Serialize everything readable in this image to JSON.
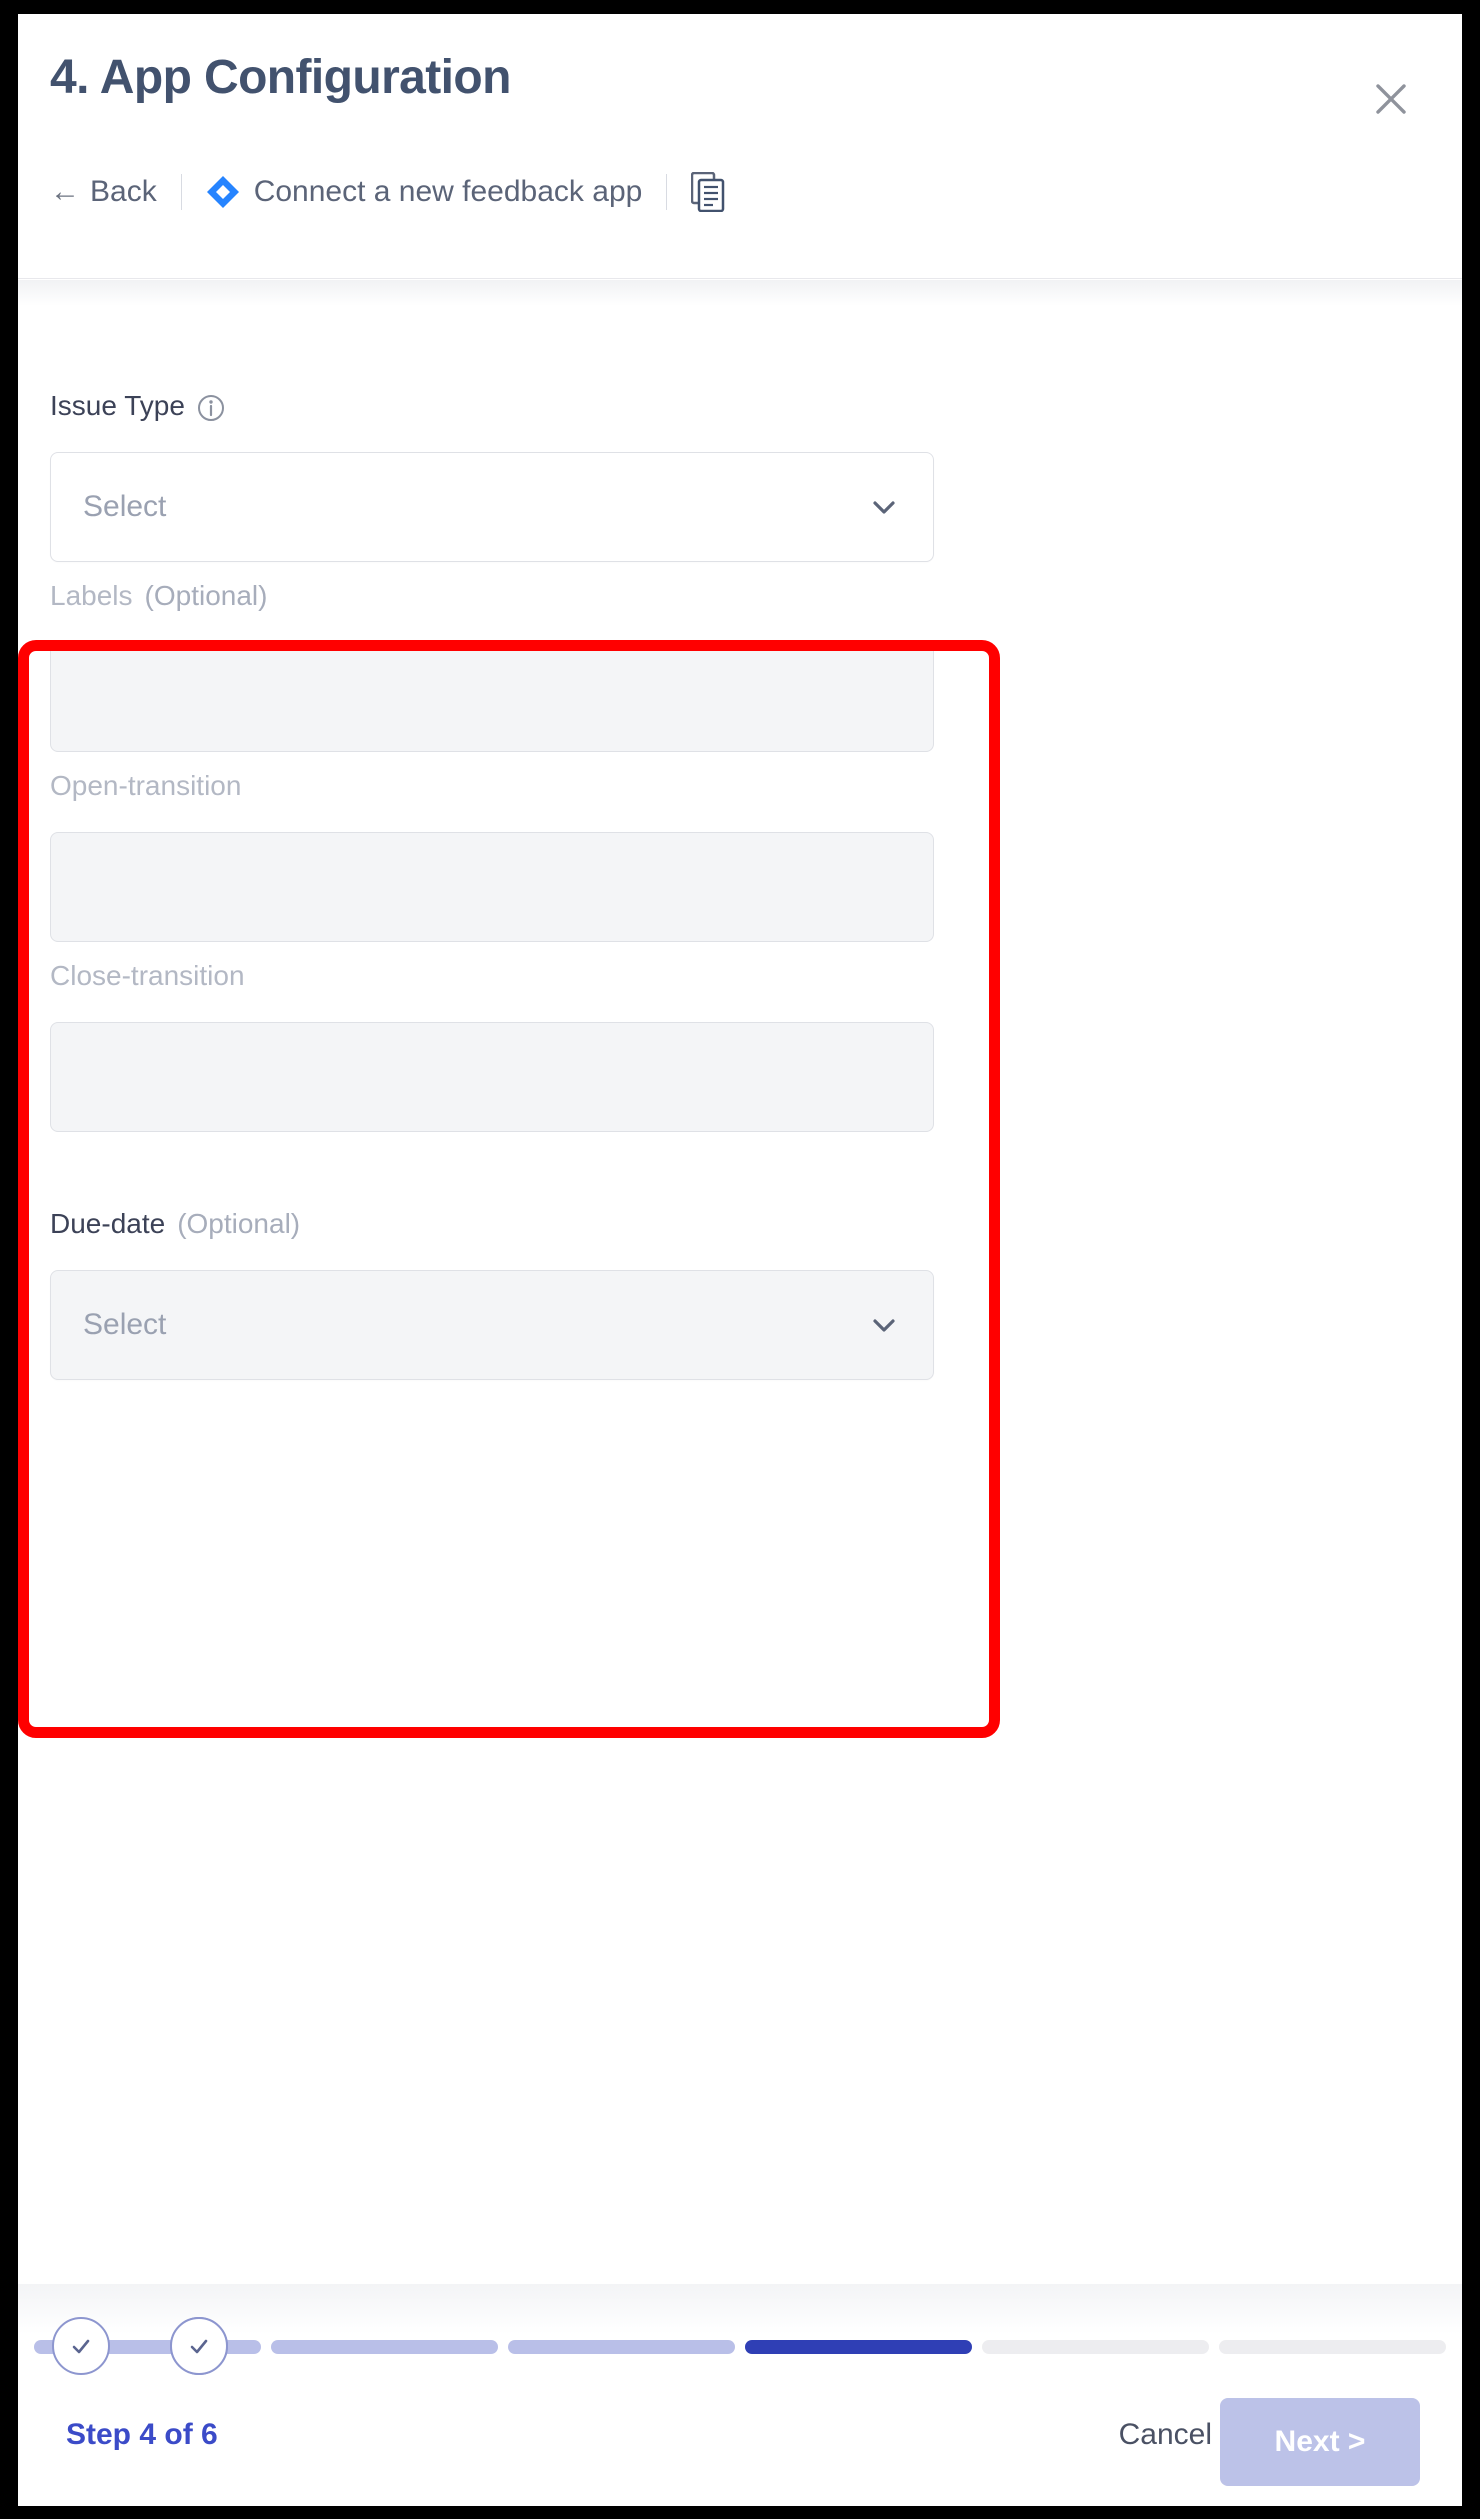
{
  "header": {
    "title": "4. App Configuration",
    "back_arrow": "←",
    "back_label": "Back",
    "app_name": "Connect a new feedback app",
    "app_icon": "jira-diamond-icon",
    "doc_icon": "document-icon",
    "close_icon": "close-icon"
  },
  "form": {
    "fields": [
      {
        "label": "Issue Type",
        "optional_suffix": "",
        "has_info_icon": true,
        "type": "select",
        "placeholder": "Select",
        "disabled": false
      },
      {
        "label": "Labels",
        "optional_suffix": "(Optional)",
        "has_info_icon": false,
        "type": "input",
        "placeholder": "",
        "disabled": true
      },
      {
        "label": "Open-transition",
        "optional_suffix": "",
        "has_info_icon": false,
        "type": "input",
        "placeholder": "",
        "disabled": true
      },
      {
        "label": "Close-transition",
        "optional_suffix": "",
        "has_info_icon": false,
        "type": "input",
        "placeholder": "",
        "disabled": true
      },
      {
        "label": "Due-date",
        "optional_suffix": "(Optional)",
        "has_info_icon": false,
        "type": "select",
        "placeholder": "Select",
        "disabled": true
      }
    ]
  },
  "footer": {
    "step_text": "Step 4 of 6",
    "cancel_label": "Cancel",
    "next_label": "Next >",
    "stepper": {
      "segments": [
        "done",
        "done",
        "done",
        "active",
        "todo",
        "todo"
      ],
      "completed_count": 3,
      "current_step": 4,
      "total_steps": 6
    }
  },
  "annotation": {
    "type": "red-highlight-box",
    "color": "#ff0000"
  },
  "colors": {
    "accent_blue": "#2f3fb5",
    "step_text_blue": "#3b4bc8",
    "jira_blue": "#2684ff",
    "annotation_red": "#ff0000",
    "title_gray": "#42526e",
    "disabled_field_bg": "#f4f5f7"
  }
}
